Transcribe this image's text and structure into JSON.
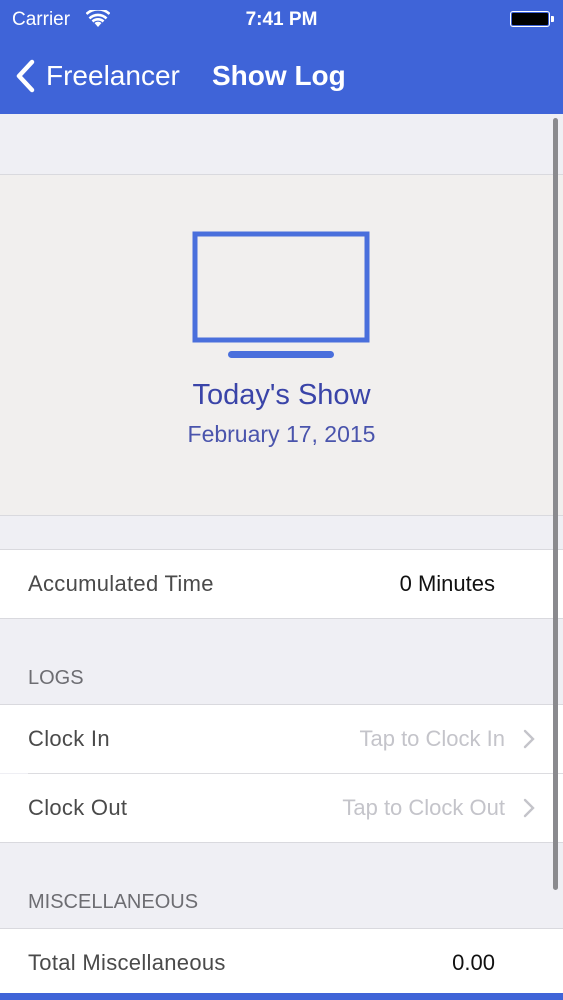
{
  "status_bar": {
    "carrier": "Carrier",
    "time": "7:41 PM"
  },
  "nav": {
    "back_label": "Freelancer",
    "title": "Show Log"
  },
  "hero": {
    "icon": "tv-icon",
    "title": "Today's Show",
    "date": "February 17, 2015"
  },
  "accumulated": {
    "label": "Accumulated Time",
    "value": "0 Minutes"
  },
  "logs": {
    "header": "LOGS",
    "clock_in": {
      "label": "Clock In",
      "value": "Tap to Clock In"
    },
    "clock_out": {
      "label": "Clock Out",
      "value": "Tap to Clock Out"
    }
  },
  "misc": {
    "header": "MISCELLANEOUS",
    "total": {
      "label": "Total Miscellaneous",
      "value": "0.00"
    }
  },
  "colors": {
    "accent": "#3f64d8",
    "title_text": "#3a44a8"
  }
}
